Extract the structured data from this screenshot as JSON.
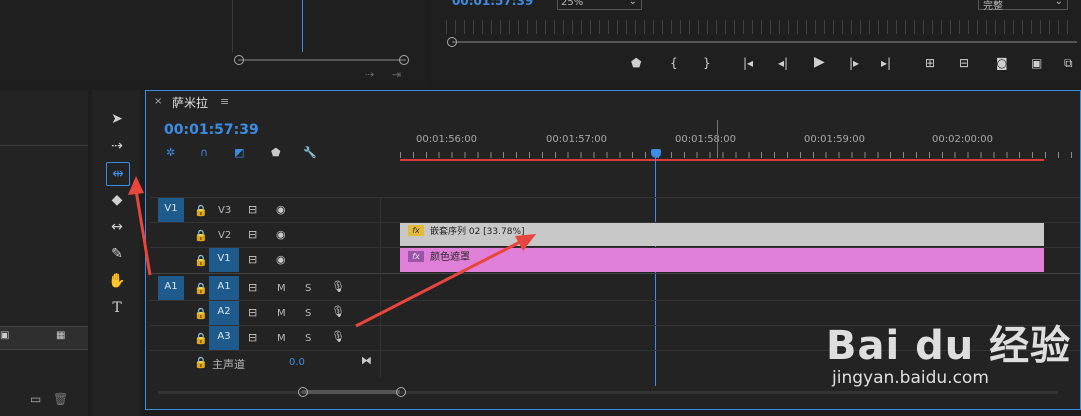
{
  "source_monitor": {
    "icons": [
      "insert-icon",
      "overwrite-icon"
    ]
  },
  "program_monitor": {
    "timecode": "00:01:57:39",
    "zoom": "25%",
    "quality": "完整",
    "transport": [
      "marker-icon",
      "in-point-icon",
      "out-point-icon",
      "go-to-in-icon",
      "step-back-icon",
      "play-icon",
      "step-forward-icon",
      "go-to-out-icon",
      "lift-icon",
      "extract-icon",
      "camera-icon",
      "compare-icon",
      "more-icon"
    ]
  },
  "timeline": {
    "close": "×",
    "sequence_name": "萨米拉",
    "menu": "≡",
    "timecode": "00:01:57:39",
    "ruler_labels": [
      "00:01:56:00",
      "00:01:57:00",
      "00:01:58:00",
      "00:01:59:00",
      "00:02:00:00"
    ],
    "video_tracks": [
      {
        "source": "V1",
        "name": "V3"
      },
      {
        "source": "",
        "name": "V2"
      },
      {
        "source": "",
        "name": "V1"
      }
    ],
    "audio_tracks": [
      {
        "source": "A1",
        "name": "A1",
        "m": "M",
        "s": "S"
      },
      {
        "source": "",
        "name": "A2",
        "m": "M",
        "s": "S"
      },
      {
        "source": "",
        "name": "A3",
        "m": "M",
        "s": "S"
      }
    ],
    "master": {
      "label": "主声道",
      "value": "0.0"
    },
    "clips": [
      {
        "fx": "fx",
        "label": "嵌套序列 02 [33.78%]",
        "color": "#c8c8c8"
      },
      {
        "fx": "fx",
        "label": "颜色遮罩",
        "color": "#e07fd8"
      }
    ]
  },
  "watermark": {
    "brand": "Bai du 经验",
    "url": "jingyan.baidu.com"
  },
  "colors": {
    "accent": "#3b8de4",
    "annotation_arrow": "#e8453c",
    "clip_nested": "#c8c8c8",
    "clip_matte": "#e07fd8"
  }
}
